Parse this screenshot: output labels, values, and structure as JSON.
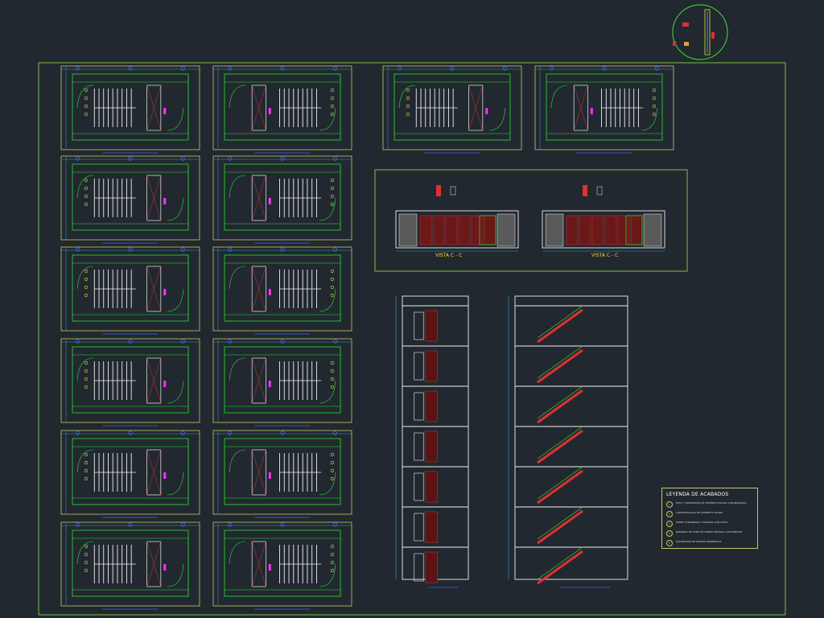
{
  "drawing": {
    "vista_label_left": "VISTA C - C",
    "vista_label_right": "VISTA C - C"
  },
  "legend": {
    "title": "LEYENDA DE ACABADOS",
    "items": [
      {
        "num": "1",
        "text": "PISO Y CONTRAPISO DE CEMENTO PULIDO CON BRUÑADO"
      },
      {
        "num": "2",
        "text": "CONTRAZOCALO DE CEMENTO PULIDO"
      },
      {
        "num": "3",
        "text": "PARED TARRAJEADA Y PINTADA CON LATEX"
      },
      {
        "num": "4",
        "text": "BARANDA DE TUBO DE FIERRO PINTADA CON ESMALTE"
      },
      {
        "num": "5",
        "text": "PASAMANOS DE MADERA BARNIZADA"
      }
    ]
  },
  "colors": {
    "background": "#212830",
    "frame": "#7fbf3f",
    "sheet": "#c8c860",
    "green": "#30e030",
    "white": "#f0f0f0",
    "red": "#e03030",
    "magenta": "#ff30ff",
    "yellow": "#e0e030",
    "cyan": "#40c0e0",
    "blue": "#4060ff"
  }
}
